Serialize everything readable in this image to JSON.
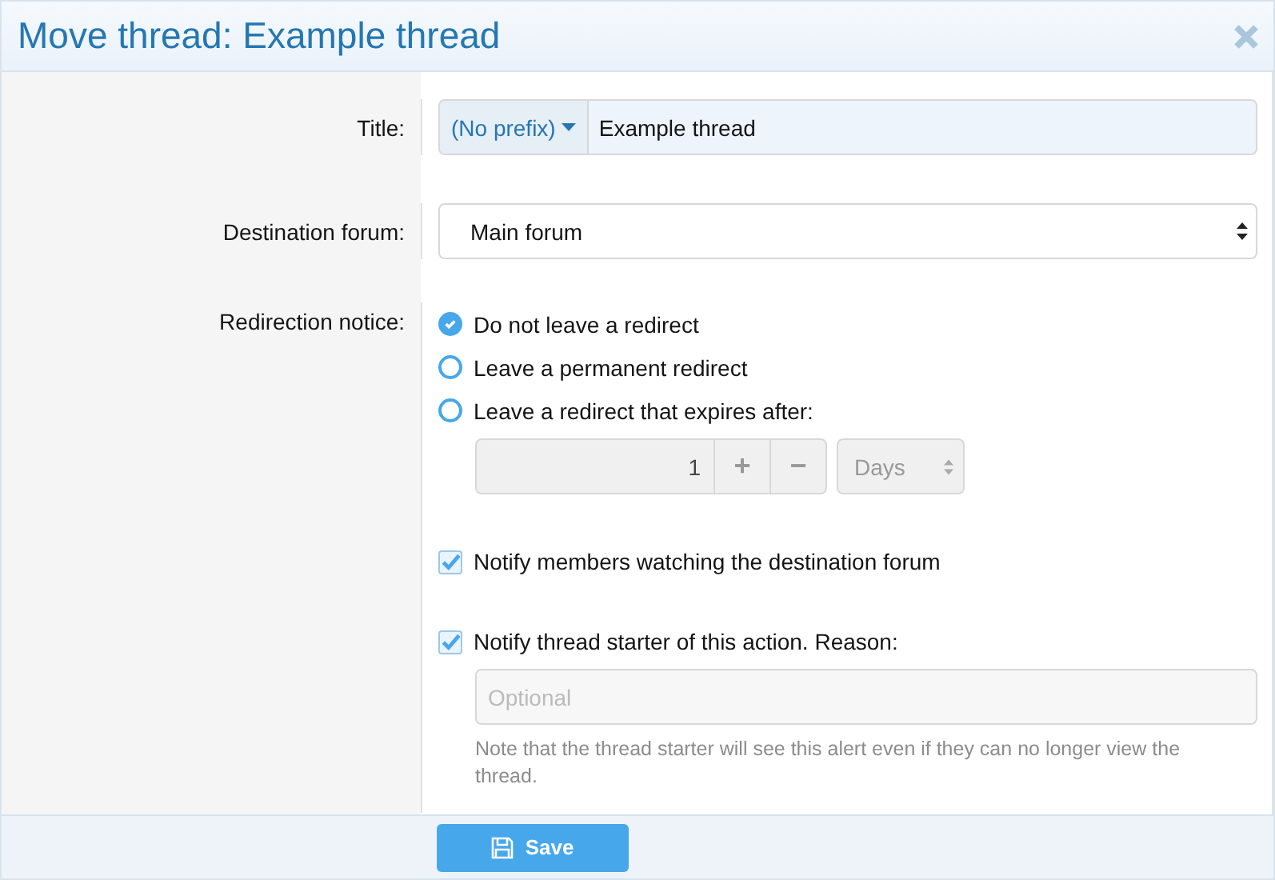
{
  "window": {
    "title": "Move thread: Example thread"
  },
  "title_row": {
    "label": "Title:",
    "prefix": "(No prefix)",
    "value": "Example thread"
  },
  "destination_row": {
    "label": "Destination forum:",
    "value": "Main forum"
  },
  "redirect_row": {
    "label": "Redirection notice:",
    "options": [
      {
        "label": "Do not leave a redirect",
        "selected": true
      },
      {
        "label": "Leave a permanent redirect",
        "selected": false
      },
      {
        "label": "Leave a redirect that expires after:",
        "selected": false
      }
    ],
    "expiry": {
      "value": "1",
      "plus": "+",
      "minus": "−",
      "unit": "Days",
      "disabled": true
    }
  },
  "notify_members": {
    "label": "Notify members watching the destination forum",
    "checked": true
  },
  "notify_starter": {
    "label": "Notify thread starter of this action. Reason:",
    "checked": true,
    "placeholder": "Optional",
    "note": "Note that the thread starter will see this alert even if they can no longer view the thread."
  },
  "footer": {
    "save": "Save"
  }
}
